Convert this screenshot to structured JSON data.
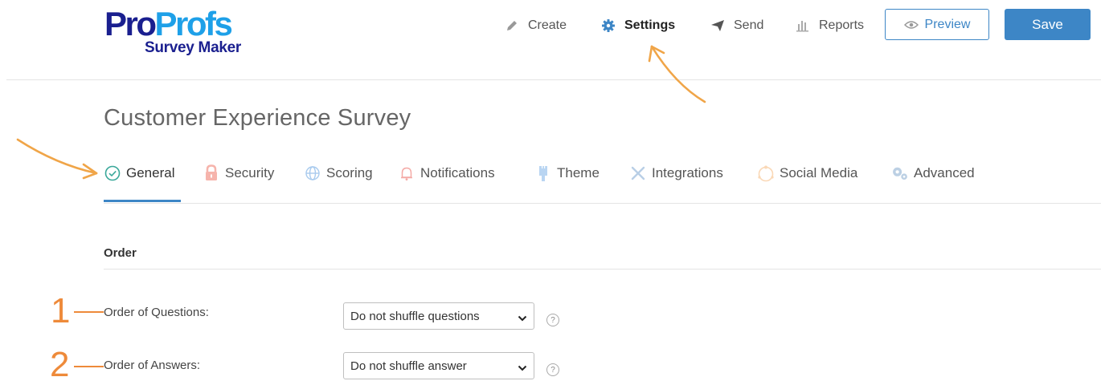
{
  "logo": {
    "pro": "Pro",
    "profs": "Profs",
    "sub": "Survey Maker"
  },
  "nav": {
    "create": "Create",
    "settings": "Settings",
    "send": "Send",
    "reports": "Reports",
    "preview": "Preview",
    "save": "Save"
  },
  "page": {
    "title": "Customer Experience Survey"
  },
  "tabs": [
    {
      "label": "General",
      "icon": "check-circle-icon"
    },
    {
      "label": "Security",
      "icon": "lock-icon"
    },
    {
      "label": "Scoring",
      "icon": "globe-icon"
    },
    {
      "label": "Notifications",
      "icon": "bell-icon"
    },
    {
      "label": "Theme",
      "icon": "paint-icon"
    },
    {
      "label": "Integrations",
      "icon": "tools-icon"
    },
    {
      "label": "Social Media",
      "icon": "social-icon"
    },
    {
      "label": "Advanced",
      "icon": "gears-icon"
    }
  ],
  "order": {
    "section_title": "Order",
    "questions_label": "Order of Questions:",
    "questions_value": "Do not shuffle questions",
    "answers_label": "Order of Answers:",
    "answers_value": "Do not shuffle answer",
    "help_glyph": "?"
  },
  "annotations": {
    "one": "1",
    "two": "2"
  },
  "colors": {
    "brand_dark": "#1a1f8f",
    "brand_light": "#1ea0e8",
    "accent": "#3d86c6",
    "annotation": "#ee8a3a"
  }
}
